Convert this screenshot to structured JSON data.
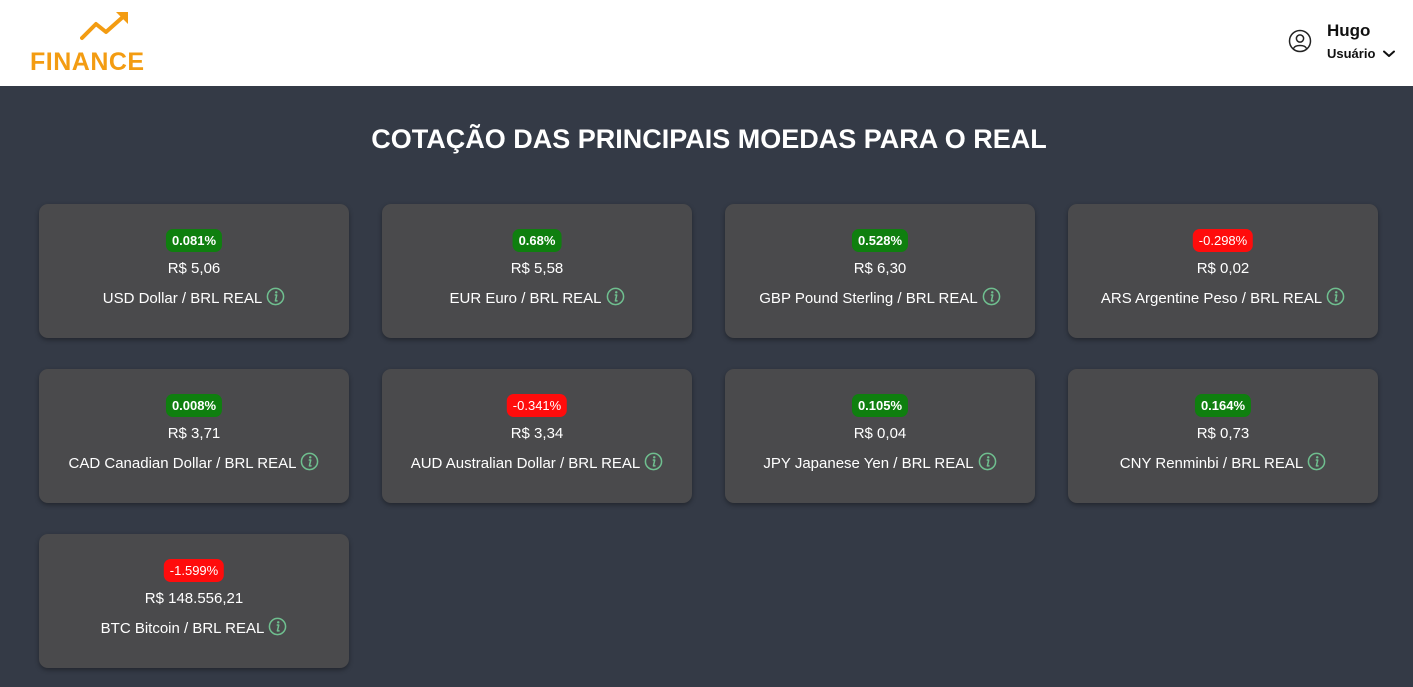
{
  "header": {
    "logo_text": "FINANCE",
    "user_name": "Hugo",
    "user_role": "Usuário"
  },
  "title": "COTAÇÃO DAS PRINCIPAIS MOEDAS PARA O REAL",
  "colors": {
    "positive": "#0f7f0f",
    "negative": "#ff0c0c",
    "brand": "#f39c12",
    "info_icon": "#6fbf8f"
  },
  "cards": [
    {
      "change": "0.081%",
      "direction": "up",
      "price": "R$ 5,06",
      "pair": "USD Dollar / BRL REAL"
    },
    {
      "change": "0.68%",
      "direction": "up",
      "price": "R$ 5,58",
      "pair": "EUR Euro / BRL REAL"
    },
    {
      "change": "0.528%",
      "direction": "up",
      "price": "R$ 6,30",
      "pair": "GBP Pound Sterling / BRL REAL"
    },
    {
      "change": "-0.298%",
      "direction": "down",
      "price": "R$ 0,02",
      "pair": "ARS Argentine Peso / BRL REAL"
    },
    {
      "change": "0.008%",
      "direction": "up",
      "price": "R$ 3,71",
      "pair": "CAD Canadian Dollar / BRL REAL"
    },
    {
      "change": "-0.341%",
      "direction": "down",
      "price": "R$ 3,34",
      "pair": "AUD Australian Dollar / BRL REAL"
    },
    {
      "change": "0.105%",
      "direction": "up",
      "price": "R$ 0,04",
      "pair": "JPY Japanese Yen / BRL REAL"
    },
    {
      "change": "0.164%",
      "direction": "up",
      "price": "R$ 0,73",
      "pair": "CNY Renminbi / BRL REAL"
    },
    {
      "change": "-1.599%",
      "direction": "down",
      "price": "R$ 148.556,21",
      "pair": "BTC Bitcoin / BRL REAL"
    }
  ]
}
